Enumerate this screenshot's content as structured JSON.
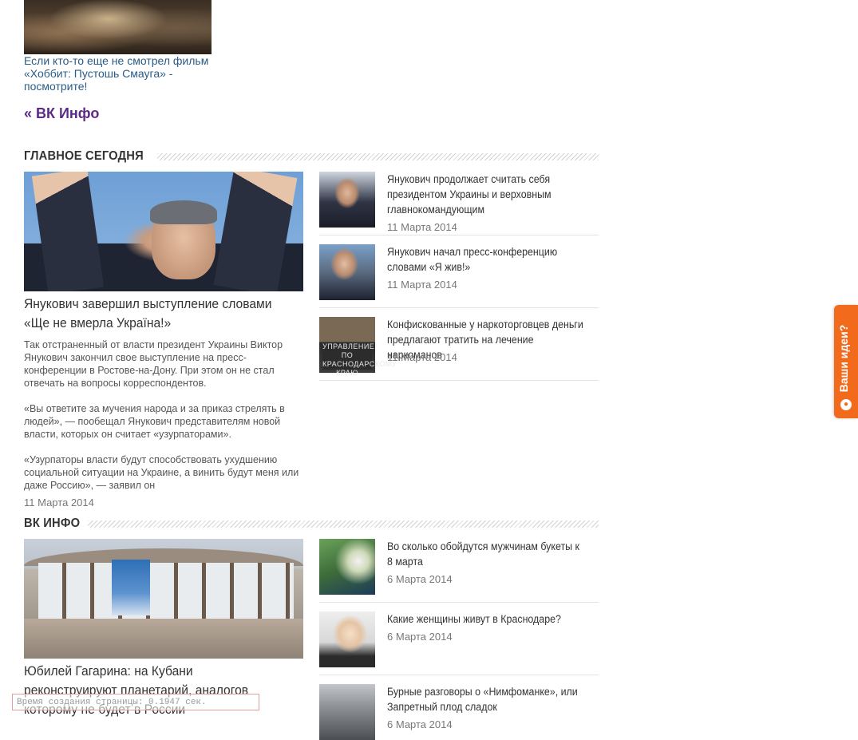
{
  "promo": {
    "link_text": "Если кто-то еще не смотрел фильм «Хоббит: Пустошь Смауга» - посмотрите!",
    "back_link": "« ВК Инфо"
  },
  "section_main": {
    "title": "ГЛАВНОЕ СЕГОДНЯ",
    "lead": {
      "title": "Янукович завершил выступление словами «Ще не вмерла Україна!»",
      "paragraphs": [
        "Так отстраненный от власти президент Украины Виктор Янукович закончил свое выступление на пресс-конференции в Ростове-на-Дону. При этом он не стал отвечать на вопросы корреспондентов.",
        "«Вы ответите за мучения народа и за приказ стрелять в людей», — пообещал Янукович представителям новой власти, которых он считает «узурпаторами».",
        "«Узурпаторы власти будут способствовать ухудшению социальной ситуации на Украине, а винить будут меня или даже Россию», — заявил он"
      ],
      "date": "11 Марта 2014"
    },
    "items": [
      {
        "title": "Янукович продолжает считать себя президентом Украины и верховным главнокомандующим",
        "date": "11 Марта 2014"
      },
      {
        "title": "Янукович начал пресс-конференцию словами «Я жив!»",
        "date": "11 Марта 2014"
      },
      {
        "title": "Конфискованные у наркоторговцев деньги предлагают тратить на лечение наркоманов",
        "date": "11 Марта 2014",
        "thumb_sign": "УПРАВЛЕНИЕ ПО КРАСНОДАРСКОМУ КРАЮ"
      }
    ]
  },
  "section_vk": {
    "title": "ВК ИНФО",
    "lead": {
      "title": "Юбилей Гагарина: на Кубани реконструируют планетарий, аналогов которому не будет в России"
    },
    "items": [
      {
        "title": "Во сколько обойдутся мужчинам букеты к 8 марта",
        "date": "6 Марта 2014"
      },
      {
        "title": "Какие женщины живут в Краснодаре?",
        "date": "6 Марта 2014"
      },
      {
        "title": "Бурные разговоры о «Нимфоманке», или Запретный плод сладок",
        "date": "6 Марта 2014"
      }
    ]
  },
  "feedback_tab": {
    "label": "Ваши идеи?",
    "icon": "lightbulb-icon"
  },
  "footer": {
    "generation_time": "Время создания страницы: 0.1947 сек."
  },
  "colors": {
    "accent_tab": "#f26b1d",
    "link": "#2a5b86",
    "back_link": "#5b2a86"
  }
}
